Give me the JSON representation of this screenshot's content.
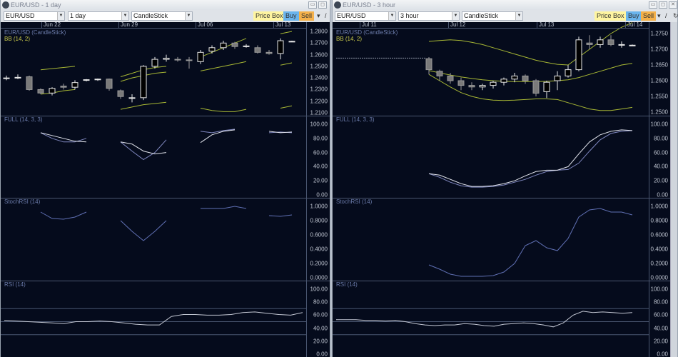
{
  "windows": [
    {
      "title": "EUR/USD - 1 day",
      "symbol": "EUR/USD",
      "interval": "1 day",
      "chart_type": "CandleStick",
      "buttons": {
        "price_box": "Price Box",
        "buy": "Buy",
        "sell": "Sell"
      },
      "time_labels": [
        "Jun 22",
        "Jun 29",
        "Jul 06",
        "Jul 13"
      ],
      "price_title": "EUR/USD (CandleStick)",
      "bb_title": "BB (14, 2)",
      "price_ticks": [
        "1.2800",
        "1.2700",
        "1.2600",
        "1.2500",
        "1.2400",
        "1.2300",
        "1.2200",
        "1.2100"
      ],
      "full_title": "FULL (14, 3, 3)",
      "full_ticks": [
        "100.00",
        "80.00",
        "60.00",
        "40.00",
        "20.00",
        "0.00"
      ],
      "stoch_title": "StochRSI (14)",
      "stoch_ticks": [
        "1.0000",
        "0.8000",
        "0.6000",
        "0.4000",
        "0.2000",
        "0.0000"
      ],
      "rsi_title": "RSI (14)",
      "rsi_ticks": [
        "100.00",
        "80.00",
        "60.00",
        "40.00",
        "20.00",
        "0.00"
      ]
    },
    {
      "title": "EUR/USD - 3 hour",
      "symbol": "EUR/USD",
      "interval": "3 hour",
      "chart_type": "CandleStick",
      "buttons": {
        "price_box": "Price Box",
        "buy": "Buy",
        "sell": "Sell"
      },
      "time_labels": [
        "Jul 11",
        "Jul 12",
        "Jul 13",
        "Jul 14"
      ],
      "price_title": "EUR/USD (CandleStick)",
      "bb_title": "BB (14, 2)",
      "price_ticks": [
        "1.2750",
        "1.2700",
        "1.2650",
        "1.2600",
        "1.2550",
        "1.2500"
      ],
      "full_title": "FULL (14, 3, 3)",
      "full_ticks": [
        "100.00",
        "80.00",
        "60.00",
        "40.00",
        "20.00",
        "0.00"
      ],
      "stoch_title": "StochRSI (14)",
      "stoch_ticks": [
        "1.0000",
        "0.8000",
        "0.6000",
        "0.4000",
        "0.2000",
        "0.0000"
      ],
      "rsi_title": "RSI (14)",
      "rsi_ticks": [
        "100.00",
        "80.00",
        "60.00",
        "40.00",
        "20.00",
        "0.00"
      ]
    }
  ],
  "colors": {
    "background": "#050b1c",
    "up_body": "#000000",
    "up_outline": "#e8e8e8",
    "down_body": "#7a7a7a",
    "bb": "#a8b834",
    "full_k": "#e4e6ee",
    "full_d": "#8088c0",
    "stoch": "#6070b4",
    "rsi": "#c4c8d4",
    "buy": "#6ab4ec",
    "sell": "#f4b04a",
    "price_box": "#fff5a0"
  },
  "chart_data": [
    {
      "type": "candlestick",
      "window": "EUR/USD - 1 day",
      "price_ylim": [
        1.21,
        1.28
      ],
      "candles": [
        [
          1.2395,
          1.242,
          1.238,
          1.24
        ],
        [
          1.24,
          1.243,
          1.239,
          1.2405
        ],
        [
          1.241,
          1.242,
          1.229,
          1.23
        ],
        [
          1.23,
          1.231,
          1.226,
          1.227
        ],
        [
          1.227,
          1.232,
          1.225,
          1.231
        ],
        [
          1.233,
          1.235,
          1.23,
          1.232
        ],
        [
          1.232,
          1.238,
          1.23,
          1.236
        ],
        [
          1.238,
          1.239,
          1.237,
          1.2385
        ],
        [
          1.2385,
          1.2395,
          1.2375,
          1.239
        ],
        [
          1.239,
          1.2395,
          1.229,
          1.231
        ],
        [
          1.229,
          1.23,
          1.222,
          1.224
        ],
        [
          1.223,
          1.226,
          1.219,
          1.223
        ],
        [
          1.223,
          1.251,
          1.221,
          1.25
        ],
        [
          1.25,
          1.258,
          1.248,
          1.256
        ],
        [
          1.256,
          1.26,
          1.254,
          1.257
        ],
        [
          1.256,
          1.258,
          1.254,
          1.2555
        ],
        [
          1.2555,
          1.258,
          1.248,
          1.255
        ],
        [
          1.254,
          1.264,
          1.252,
          1.262
        ],
        [
          1.263,
          1.268,
          1.261,
          1.266
        ],
        [
          1.266,
          1.272,
          1.264,
          1.27
        ],
        [
          1.27,
          1.271,
          1.265,
          1.267
        ],
        [
          1.267,
          1.269,
          1.266,
          1.2675
        ],
        [
          1.266,
          1.268,
          1.261,
          1.262
        ],
        [
          1.262,
          1.264,
          1.26,
          1.261
        ],
        [
          1.261,
          1.274,
          1.256,
          1.272
        ],
        [
          1.2715,
          1.272,
          1.271,
          1.2715
        ]
      ],
      "bb_upper": [
        null,
        null,
        null,
        1.247,
        1.248,
        1.249,
        1.25,
        null,
        null,
        null,
        1.241,
        1.244,
        1.247,
        1.249,
        1.25,
        null,
        null,
        1.258,
        1.262,
        1.266,
        1.27,
        1.274,
        null,
        null,
        1.278,
        1.28
      ],
      "bb_middle": [
        null,
        null,
        null,
        null,
        null,
        null,
        null,
        null,
        null,
        null,
        1.237,
        1.24,
        1.242,
        1.244,
        1.245,
        null,
        null,
        1.246,
        1.248,
        1.25,
        1.252,
        1.254,
        null,
        null,
        1.251,
        1.253
      ],
      "bb_lower": [
        null,
        null,
        null,
        1.226,
        1.227,
        1.229,
        1.23,
        null,
        null,
        null,
        1.213,
        1.215,
        1.217,
        1.218,
        1.219,
        null,
        null,
        1.214,
        1.212,
        1.211,
        1.211,
        1.213,
        null,
        null,
        1.214,
        1.216
      ],
      "full_k": [
        null,
        null,
        null,
        88,
        84,
        80,
        76,
        75,
        null,
        null,
        75,
        72,
        62,
        58,
        60,
        null,
        null,
        74,
        85,
        90,
        92,
        null,
        null,
        90,
        88,
        89
      ],
      "full_d": [
        null,
        null,
        null,
        88,
        80,
        75,
        75,
        80,
        null,
        null,
        75,
        62,
        50,
        60,
        78,
        null,
        null,
        90,
        88,
        91,
        93,
        null,
        null,
        88,
        89,
        88
      ],
      "stochrsi": [
        null,
        null,
        null,
        0.92,
        0.83,
        0.82,
        0.85,
        0.92,
        null,
        null,
        0.8,
        0.65,
        0.52,
        0.65,
        0.8,
        null,
        null,
        0.97,
        0.97,
        0.97,
        1.0,
        0.97,
        null,
        0.87,
        0.86,
        0.88
      ],
      "rsi": [
        52,
        51,
        50,
        49,
        48,
        47,
        50,
        50,
        51,
        50,
        48,
        46,
        45,
        45,
        58,
        61,
        61,
        60,
        60,
        61,
        64,
        65,
        63,
        61,
        60,
        64
      ]
    },
    {
      "type": "candlestick",
      "window": "EUR/USD - 3 hour",
      "price_ylim": [
        1.25,
        1.275
      ],
      "flat_line": 1.2672,
      "candles": [
        [
          1.267,
          1.2675,
          1.262,
          1.2635
        ],
        [
          1.263,
          1.2635,
          1.26,
          1.2615
        ],
        [
          1.2615,
          1.2625,
          1.259,
          1.26
        ],
        [
          1.26,
          1.261,
          1.257,
          1.2585
        ],
        [
          1.2585,
          1.2595,
          1.257,
          1.258
        ],
        [
          1.258,
          1.259,
          1.257,
          1.2585
        ],
        [
          1.2585,
          1.26,
          1.2575,
          1.2595
        ],
        [
          1.2595,
          1.261,
          1.2585,
          1.2605
        ],
        [
          1.2605,
          1.2625,
          1.2595,
          1.2615
        ],
        [
          1.2615,
          1.262,
          1.259,
          1.26
        ],
        [
          1.26,
          1.2605,
          1.255,
          1.256
        ],
        [
          1.2565,
          1.26,
          1.2545,
          1.2595
        ],
        [
          1.26,
          1.263,
          1.257,
          1.2615
        ],
        [
          1.2615,
          1.265,
          1.261,
          1.2635
        ],
        [
          1.2635,
          1.274,
          1.263,
          1.273
        ],
        [
          1.272,
          1.2745,
          1.27,
          1.2715
        ],
        [
          1.2715,
          1.274,
          1.2705,
          1.273
        ],
        [
          1.273,
          1.2745,
          1.271,
          1.2715
        ],
        [
          1.2715,
          1.2725,
          1.2705,
          1.2715
        ],
        [
          1.2713,
          1.2715,
          1.2711,
          1.2713
        ]
      ],
      "bb_upper": [
        1.2725,
        1.2728,
        1.273,
        1.2728,
        1.2722,
        1.2715,
        1.2705,
        1.2695,
        1.2685,
        1.2675,
        1.2665,
        1.2658,
        1.2652,
        1.265,
        1.2675,
        1.27,
        1.2725,
        1.275,
        1.277,
        1.2785
      ],
      "bb_middle": [
        1.2632,
        1.2625,
        1.2618,
        1.2612,
        1.2607,
        1.2603,
        1.26,
        1.2598,
        1.2597,
        1.2597,
        1.2597,
        1.2598,
        1.26,
        1.2603,
        1.261,
        1.262,
        1.263,
        1.264,
        1.265,
        1.2655
      ],
      "bb_lower": [
        1.262,
        1.26,
        1.258,
        1.2562,
        1.255,
        1.2542,
        1.2538,
        1.2537,
        1.2538,
        1.254,
        1.2542,
        1.2542,
        1.254,
        1.253,
        1.252,
        1.251,
        1.2505,
        1.2505,
        1.251,
        1.2515
      ],
      "full_k": [
        30,
        28,
        22,
        16,
        12,
        12,
        13,
        16,
        20,
        27,
        33,
        35,
        35,
        40,
        58,
        75,
        85,
        90,
        92,
        91
      ],
      "full_d": [
        30,
        25,
        18,
        13,
        11,
        11,
        12,
        14,
        18,
        22,
        28,
        33,
        35,
        36,
        45,
        62,
        78,
        87,
        90,
        91
      ],
      "stochrsi": [
        0.18,
        0.12,
        0.05,
        0.02,
        0.02,
        0.02,
        0.03,
        0.08,
        0.2,
        0.45,
        0.52,
        0.42,
        0.38,
        0.55,
        0.85,
        0.95,
        0.97,
        0.92,
        0.92,
        0.88
      ],
      "rsi": [
        53,
        53,
        53,
        52,
        52,
        51,
        52,
        50,
        47,
        45,
        44,
        45,
        45,
        47,
        46,
        44,
        43,
        46,
        47,
        48,
        47,
        45,
        42,
        48,
        60,
        66,
        64,
        65,
        64,
        63,
        64
      ]
    }
  ]
}
